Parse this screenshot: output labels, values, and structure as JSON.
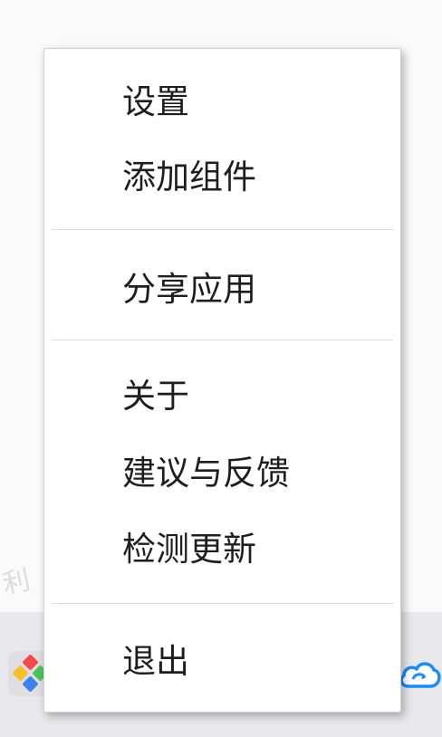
{
  "background": {
    "watermark_text": "利 比"
  },
  "menu": {
    "groups": [
      {
        "items": [
          {
            "label": "设置"
          },
          {
            "label": "添加组件"
          }
        ]
      },
      {
        "items": [
          {
            "label": "分享应用"
          }
        ]
      },
      {
        "items": [
          {
            "label": "关于"
          },
          {
            "label": "建议与反馈"
          },
          {
            "label": "检测更新"
          }
        ]
      },
      {
        "items": [
          {
            "label": "退出"
          }
        ]
      }
    ]
  },
  "icons": {
    "app": "colorful-tiles-app-icon",
    "tray": "cloud-sync-icon"
  },
  "colors": {
    "menu_text": "#1e1e22",
    "separator": "#dadade",
    "cloud_accent": "#1a8cff",
    "tile_red": "#f04a4a",
    "tile_green": "#4cc35a",
    "tile_yellow": "#f7c02b",
    "tile_blue": "#3b82f0"
  }
}
